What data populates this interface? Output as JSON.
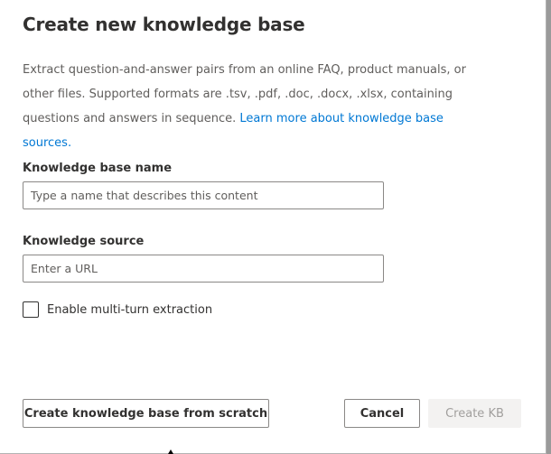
{
  "dialog": {
    "title": "Create new knowledge base",
    "description": "Extract question-and-answer pairs from an online FAQ, product manuals, or other files. Supported formats are .tsv, .pdf, .doc, .docx, .xlsx, containing questions and answers in sequence. ",
    "learn_more_link": "Learn more about knowledge base sources."
  },
  "form": {
    "kb_name": {
      "label": "Knowledge base name",
      "value": "",
      "placeholder": "Type a name that describes this content"
    },
    "kb_source": {
      "label": "Knowledge source",
      "value": "",
      "placeholder": "Enter a URL"
    },
    "multi_turn": {
      "label": "Enable multi-turn extraction",
      "checked": false
    }
  },
  "footer": {
    "create_from_scratch_label": "Create knowledge base from scratch",
    "cancel_label": "Cancel",
    "create_kb_label": "Create KB"
  },
  "colors": {
    "link": "#0078d4",
    "text_primary": "#323130",
    "text_secondary": "#605e5c",
    "disabled_bg": "#f3f2f1",
    "disabled_text": "#a19f9d",
    "input_border": "#8a8886"
  }
}
